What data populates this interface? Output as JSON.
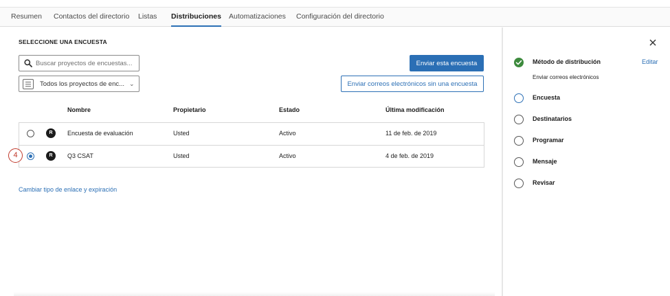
{
  "tabs": [
    {
      "label": "Resumen"
    },
    {
      "label": "Contactos del directorio"
    },
    {
      "label": "Listas"
    },
    {
      "label": "Distribuciones"
    },
    {
      "label": "Automatizaciones"
    },
    {
      "label": "Configuración del directorio"
    }
  ],
  "active_tab": "Distribuciones",
  "main": {
    "section_title": "SELECCIONE UNA ENCUESTA",
    "search": {
      "placeholder": "Buscar proyectos de encuestas..."
    },
    "filter": {
      "selected": "Todos los proyectos de enc...",
      "icon": "list-icon"
    },
    "send_button": "Enviar esta encuesta",
    "send_without_button": "Enviar correos electrónicos sin una encuesta",
    "table": {
      "headers": {
        "name": "Nombre",
        "owner": "Propietario",
        "status": "Estado",
        "modified": "Última modificación"
      },
      "rows": [
        {
          "badge": "R",
          "name": "Encuesta de evaluación",
          "owner": "Usted",
          "status": "Activo",
          "modified": "11 de feb. de 2019",
          "selected": false
        },
        {
          "badge": "R",
          "name": "Q3 CSAT",
          "owner": "Usted",
          "status": "Activo",
          "modified": "4 de feb. de 2019",
          "selected": true
        }
      ]
    },
    "step_callout": "4",
    "change_link": "Cambiar tipo de enlace y expiración"
  },
  "panel": {
    "steps": [
      {
        "label": "Método de distribución",
        "state": "done",
        "sub": "Enviar correos electrónicos",
        "edit": "Editar"
      },
      {
        "label": "Encuesta",
        "state": "active"
      },
      {
        "label": "Destinatarios",
        "state": "pending"
      },
      {
        "label": "Programar",
        "state": "pending"
      },
      {
        "label": "Mensaje",
        "state": "pending"
      },
      {
        "label": "Revisar",
        "state": "pending"
      }
    ]
  },
  "colors": {
    "accent": "#2b6fb5",
    "done": "#3d8a3d",
    "callout": "#c0392b"
  }
}
